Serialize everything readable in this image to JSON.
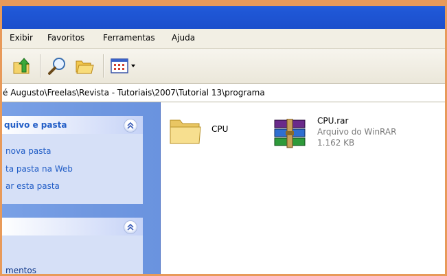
{
  "menu": {
    "items": [
      "Exibir",
      "Favoritos",
      "Ferramentas",
      "Ajuda"
    ]
  },
  "toolbar": {
    "buttons": [
      "up-folder-icon",
      "search-icon",
      "folders-icon",
      "views-icon"
    ]
  },
  "address": {
    "path": "é Augusto\\Freelas\\Revista - Tutoriais\\2007\\Tutorial 13\\programa"
  },
  "sidebar": {
    "tasks_box": {
      "title": "quivo e pasta",
      "links": [
        "nova pasta",
        "ta pasta na Web",
        "ar esta pasta"
      ]
    },
    "other_box": {
      "title": "",
      "links": [
        "mentos"
      ]
    }
  },
  "files": [
    {
      "name": "CPU",
      "icon": "folder-icon"
    },
    {
      "name": "CPU.rar",
      "type": "Arquivo do WinRAR",
      "size": "1.162 KB",
      "icon": "winrar-archive-icon"
    }
  ],
  "colors": {
    "titlebar": "#1f57d6",
    "sidebar": "#6f97e0",
    "task_link": "#215dc6",
    "frame_border": "#e89a5a"
  }
}
